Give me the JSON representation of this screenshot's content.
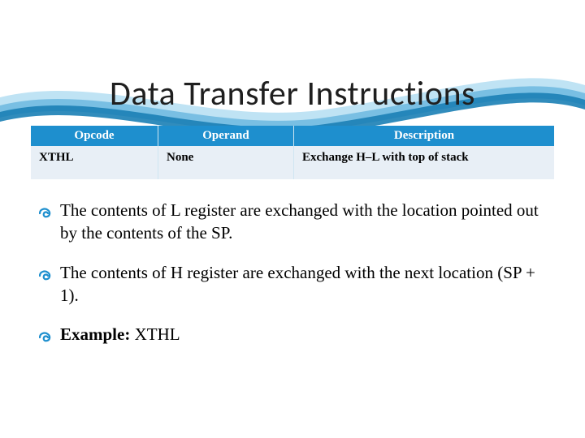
{
  "title": "Data Transfer Instructions",
  "table": {
    "headers": [
      "Opcode",
      "Operand",
      "Description"
    ],
    "row": {
      "opcode": "XTHL",
      "operand": "None",
      "description": "Exchange H–L with top of stack"
    }
  },
  "bullets": [
    "The contents of L register are exchanged with the location pointed out by the contents of the SP.",
    "The contents of H register are exchanged with the next location (SP + 1)."
  ],
  "example": {
    "label": "Example:",
    "value": "XTHL"
  },
  "colors": {
    "accent": "#1e8fce",
    "wave_light": "#bfe3f4",
    "wave_mid": "#6cb9df",
    "wave_deep": "#1b7fb5",
    "bullet": "#1e8fce"
  }
}
